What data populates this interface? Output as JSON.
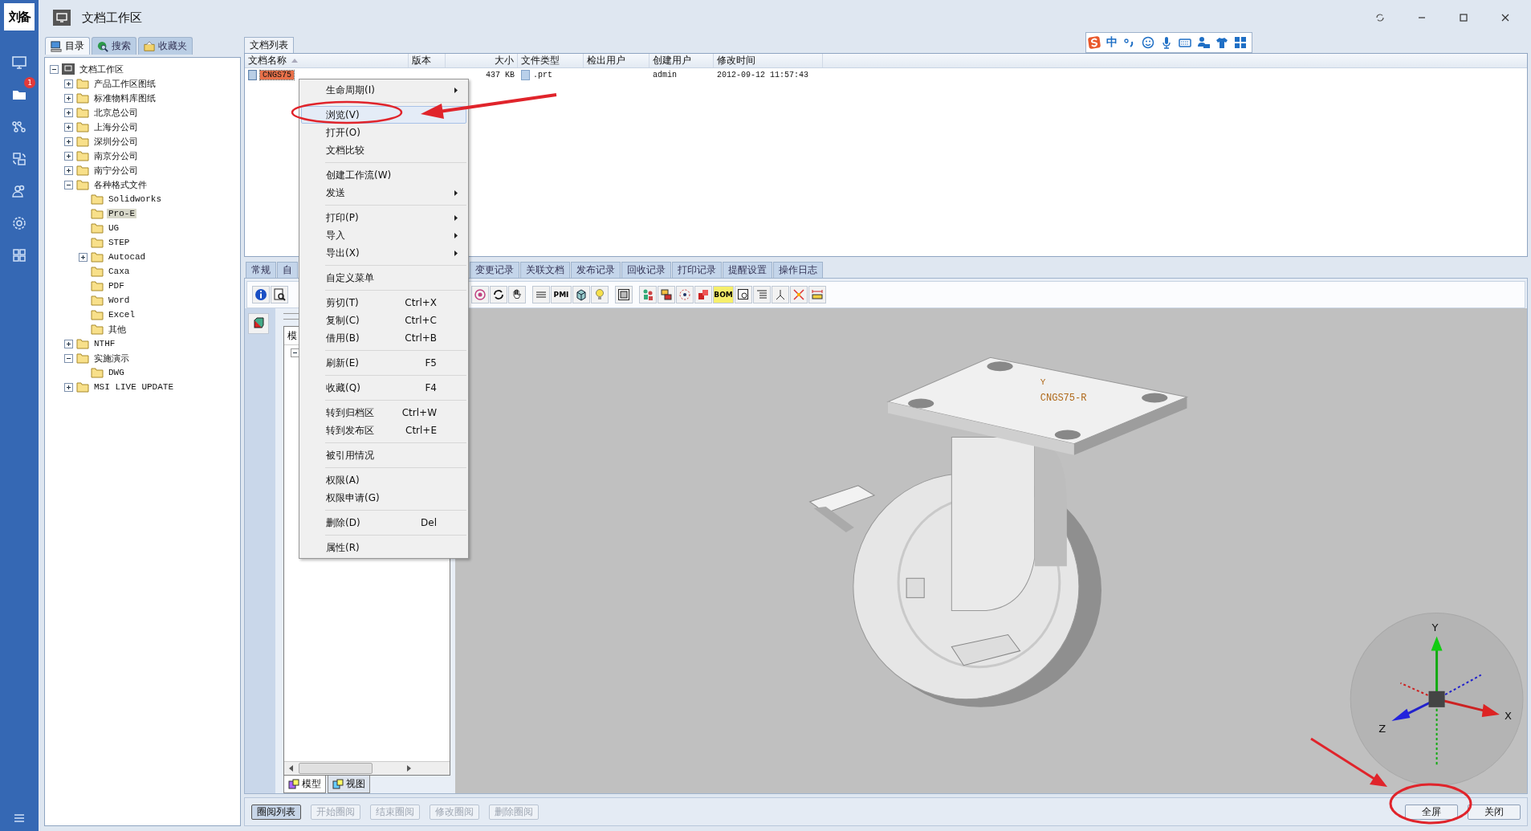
{
  "rail": {
    "logo": "刘备",
    "badge": "1"
  },
  "window": {
    "title": "文档工作区"
  },
  "ime_bar": {
    "mode": "中"
  },
  "left_tabs": [
    {
      "label": "目录",
      "selected": true
    },
    {
      "label": "搜索",
      "selected": false
    },
    {
      "label": "收藏夹",
      "selected": false
    }
  ],
  "tree": {
    "items": [
      {
        "label": "文档工作区",
        "expanded": true,
        "selected": false,
        "children": [
          {
            "label": "产品工作区图纸",
            "expanded": false,
            "selected": false
          },
          {
            "label": "标准物料库图纸",
            "expanded": false,
            "selected": false
          },
          {
            "label": "北京总公司",
            "expanded": false,
            "selected": false
          },
          {
            "label": "上海分公司",
            "expanded": false,
            "selected": false
          },
          {
            "label": "深圳分公司",
            "expanded": false,
            "selected": false
          },
          {
            "label": "南京分公司",
            "expanded": false,
            "selected": false
          },
          {
            "label": "南宁分公司",
            "expanded": false,
            "selected": false
          },
          {
            "label": "各种格式文件",
            "expanded": true,
            "selected": false,
            "children": [
              {
                "label": "Solidworks",
                "selected": false
              },
              {
                "label": "Pro-E",
                "selected": true
              },
              {
                "label": "UG",
                "selected": false
              },
              {
                "label": "STEP",
                "selected": false
              },
              {
                "label": "Autocad",
                "expanded": false,
                "selected": false
              },
              {
                "label": "Caxa",
                "selected": false
              },
              {
                "label": "PDF",
                "selected": false
              },
              {
                "label": "Word",
                "selected": false
              },
              {
                "label": "Excel",
                "selected": false
              },
              {
                "label": "其他",
                "selected": false
              }
            ]
          },
          {
            "label": "NTHF",
            "expanded": false,
            "selected": false
          },
          {
            "label": "实施演示",
            "expanded": true,
            "selected": false,
            "children": [
              {
                "label": "DWG",
                "selected": false
              }
            ]
          },
          {
            "label": "MSI LIVE UPDATE",
            "expanded": false,
            "selected": false
          }
        ]
      }
    ]
  },
  "document_list": {
    "tab": "文档列表",
    "columns": [
      "文档名称",
      "版本",
      "大小",
      "文件类型",
      "检出用户",
      "创建用户",
      "修改时间"
    ],
    "rows": [
      {
        "name": "CNGS75",
        "size": "437 KB",
        "type": ".prt",
        "creator": "admin",
        "modified": "2012-09-12 11:57:43",
        "selected": true
      }
    ]
  },
  "context_menu": {
    "groups": [
      [
        {
          "label": "生命周期(I)",
          "submenu": true,
          "selected": false
        }
      ],
      [
        {
          "label": "浏览(V)",
          "submenu": false,
          "selected": true
        },
        {
          "label": "打开(O)",
          "submenu": false,
          "selected": false
        },
        {
          "label": "文档比较",
          "submenu": false,
          "selected": false
        }
      ],
      [
        {
          "label": "创建工作流(W)",
          "submenu": false,
          "selected": false
        },
        {
          "label": "发送",
          "submenu": true,
          "selected": false
        }
      ],
      [
        {
          "label": "打印(P)",
          "submenu": true,
          "selected": false
        },
        {
          "label": "导入",
          "submenu": true,
          "selected": false
        },
        {
          "label": "导出(X)",
          "submenu": true,
          "selected": false
        }
      ],
      [
        {
          "label": "自定义菜单",
          "submenu": false,
          "selected": false
        }
      ],
      [
        {
          "label": "剪切(T)",
          "shortcut": "Ctrl+X",
          "submenu": false,
          "selected": false
        },
        {
          "label": "复制(C)",
          "shortcut": "Ctrl+C",
          "submenu": false,
          "selected": false
        },
        {
          "label": "借用(B)",
          "shortcut": "Ctrl+B",
          "submenu": false,
          "selected": false
        }
      ],
      [
        {
          "label": "刷新(E)",
          "shortcut": "F5",
          "submenu": false,
          "selected": false
        }
      ],
      [
        {
          "label": "收藏(Q)",
          "shortcut": "F4",
          "submenu": false,
          "selected": false
        }
      ],
      [
        {
          "label": "转到归档区",
          "shortcut": "Ctrl+W",
          "submenu": false,
          "selected": false
        },
        {
          "label": "转到发布区",
          "shortcut": "Ctrl+E",
          "submenu": false,
          "selected": false
        }
      ],
      [
        {
          "label": "被引用情况",
          "submenu": false,
          "selected": false
        }
      ],
      [
        {
          "label": "权限(A)",
          "submenu": false,
          "selected": false
        },
        {
          "label": "权限申请(G)",
          "submenu": false,
          "selected": false
        }
      ],
      [
        {
          "label": "删除(D)",
          "shortcut": "Del",
          "submenu": false,
          "selected": false
        }
      ],
      [
        {
          "label": "属性(R)",
          "submenu": false,
          "selected": false
        }
      ]
    ]
  },
  "detail_tabs_left": [
    {
      "label": "常规",
      "selected": false
    },
    {
      "label": "自",
      "selected": false
    }
  ],
  "detail_tabs_right": [
    {
      "label": "变更记录",
      "selected": false
    },
    {
      "label": "关联文档",
      "selected": false
    },
    {
      "label": "发布记录",
      "selected": false
    },
    {
      "label": "回收记录",
      "selected": false
    },
    {
      "label": "打印记录",
      "selected": false
    },
    {
      "label": "提醒设置",
      "selected": false
    },
    {
      "label": "操作日志",
      "selected": false
    }
  ],
  "toolbar": {
    "pmi": "PMI",
    "bom": "BOM"
  },
  "model_panel": {
    "header": "模",
    "tabs": [
      {
        "label": "模型",
        "selected": true
      },
      {
        "label": "视图",
        "selected": false
      }
    ]
  },
  "viewer": {
    "part_label": "CNGS75-R",
    "part_axis": "Y",
    "axes": {
      "x": "X",
      "y": "Y",
      "z": "Z"
    }
  },
  "review_buttons": [
    {
      "label": "圈阅列表",
      "disabled": false
    },
    {
      "label": "开始圈阅",
      "disabled": true
    },
    {
      "label": "结束圈阅",
      "disabled": true
    },
    {
      "label": "修改圈阅",
      "disabled": true
    },
    {
      "label": "删除圈阅",
      "disabled": true
    }
  ],
  "window_buttons": [
    {
      "label": "全屏"
    },
    {
      "label": "关闭"
    }
  ]
}
